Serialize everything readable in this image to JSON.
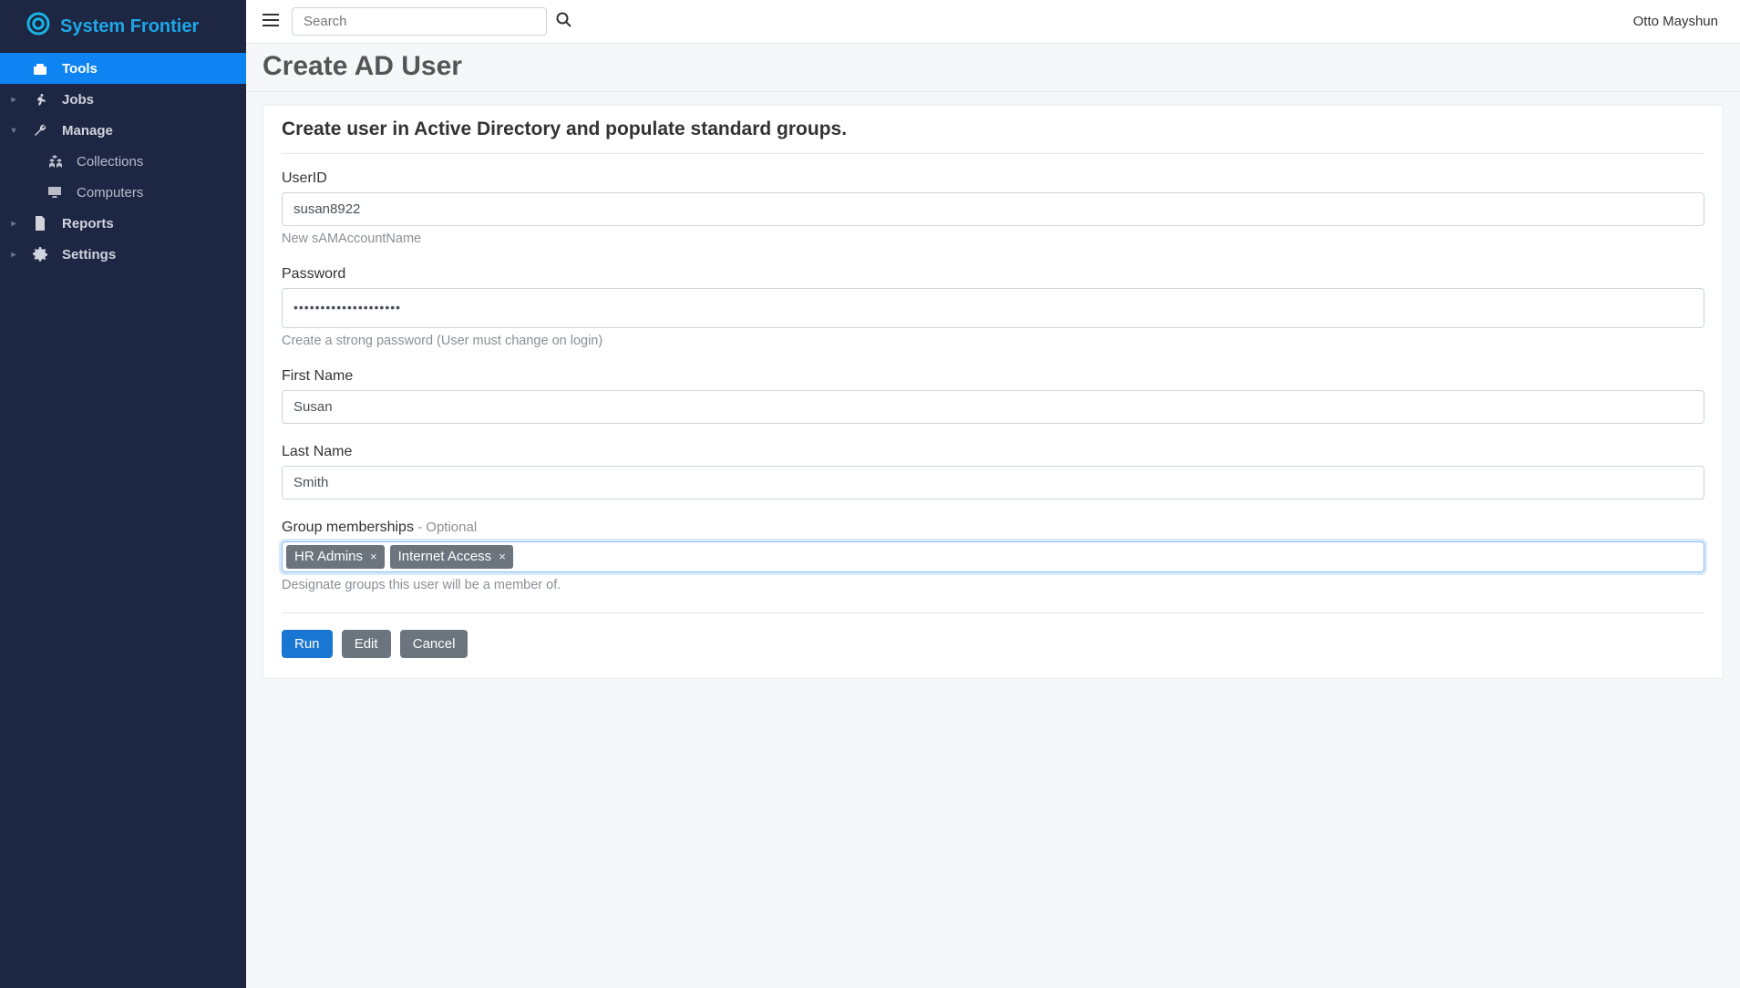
{
  "brand": {
    "name": "System Frontier"
  },
  "topbar": {
    "search_placeholder": "Search",
    "user_name": "Otto Mayshun"
  },
  "sidebar": {
    "items": [
      {
        "label": "Tools",
        "icon": "toolbox",
        "active": true,
        "has_children": false
      },
      {
        "label": "Jobs",
        "icon": "running",
        "active": false,
        "has_children": true
      },
      {
        "label": "Manage",
        "icon": "wrench",
        "active": false,
        "has_children": true,
        "expanded": true,
        "children": [
          {
            "label": "Collections",
            "icon": "cubes"
          },
          {
            "label": "Computers",
            "icon": "desktop"
          }
        ]
      },
      {
        "label": "Reports",
        "icon": "file",
        "active": false,
        "has_children": true
      },
      {
        "label": "Settings",
        "icon": "gear",
        "active": false,
        "has_children": true
      }
    ]
  },
  "page": {
    "title": "Create AD User",
    "subtitle": "Create user in Active Directory and populate standard groups."
  },
  "form": {
    "userid": {
      "label": "UserID",
      "value": "susan8922",
      "help": "New sAMAccountName"
    },
    "password": {
      "label": "Password",
      "value": "••••••••••••••••••••",
      "help": "Create a strong password (User must change on login)"
    },
    "first": {
      "label": "First Name",
      "value": "Susan"
    },
    "last": {
      "label": "Last Name",
      "value": "Smith"
    },
    "groups": {
      "label": "Group memberships",
      "optional_suffix": " - Optional",
      "help": "Designate groups this user will be a member of.",
      "tags": [
        "HR Admins",
        "Internet Access"
      ]
    }
  },
  "buttons": {
    "run": "Run",
    "edit": "Edit",
    "cancel": "Cancel"
  }
}
